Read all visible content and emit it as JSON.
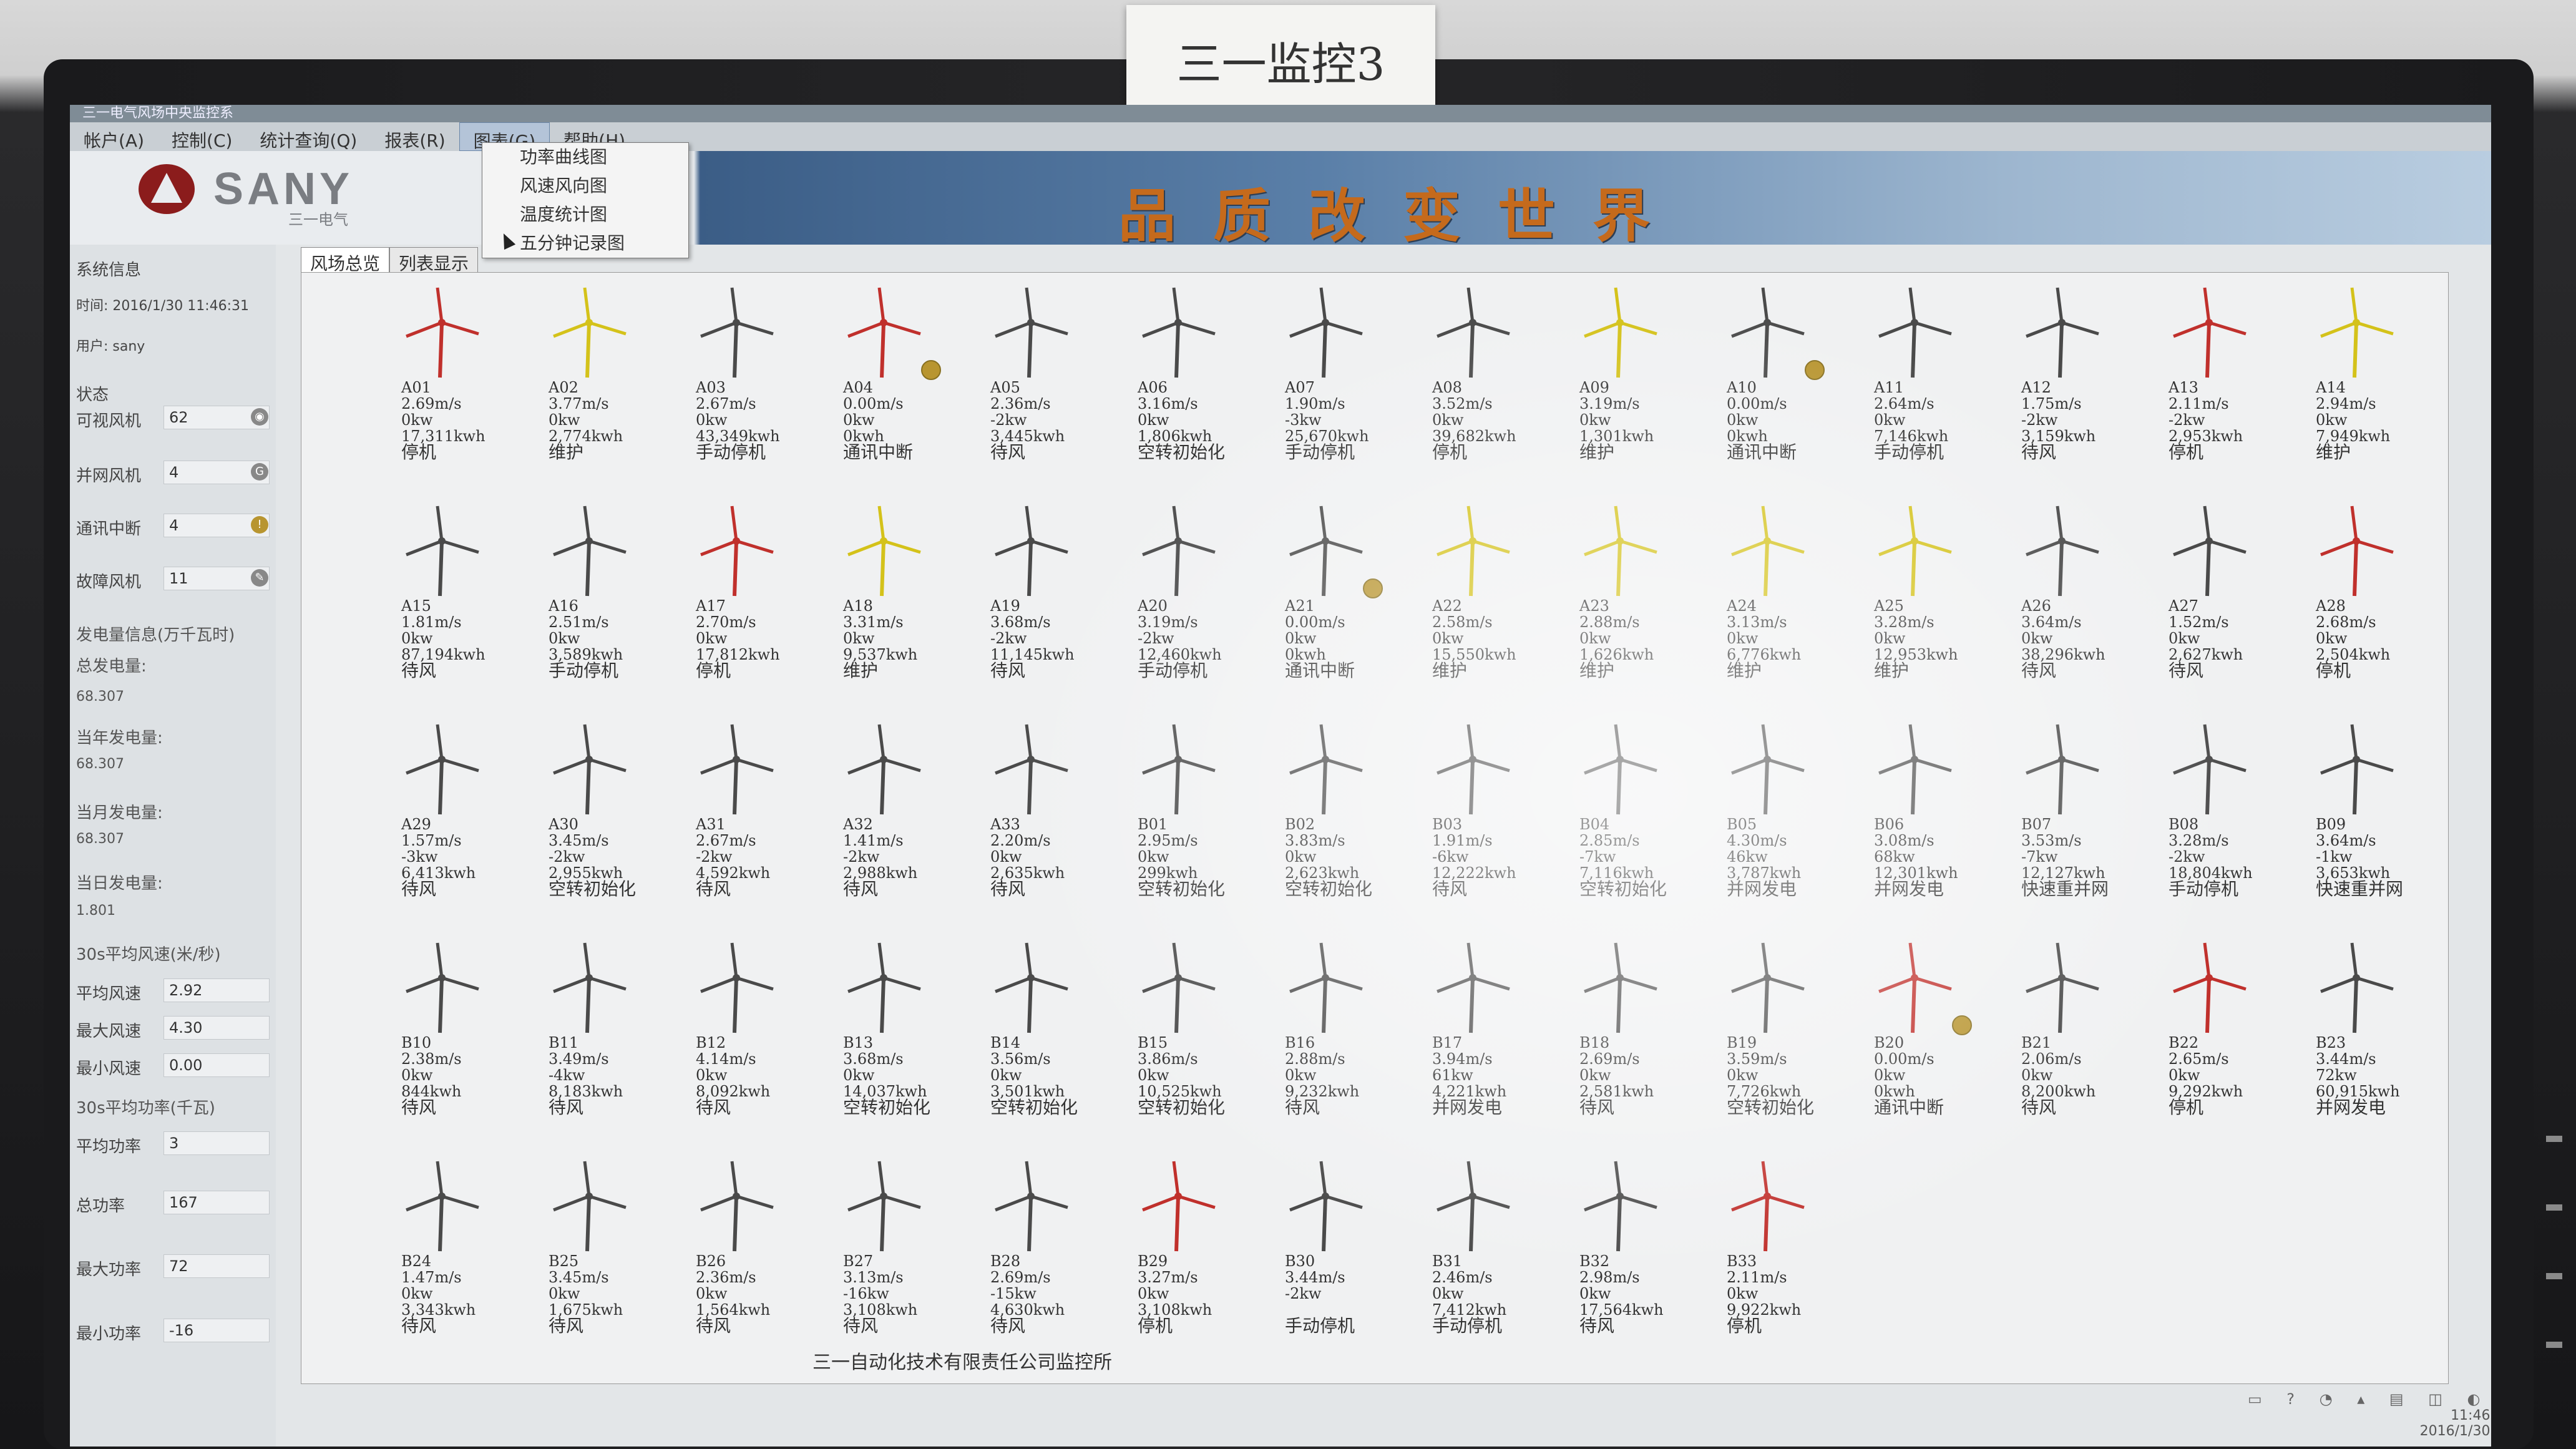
{
  "label_on_monitor": "三一监控3",
  "window_title": "三一电气风场中央监控系",
  "menu": [
    "帐户(A)",
    "控制(C)",
    "统计查询(Q)",
    "报表(R)",
    "图表(G)",
    "帮助(H)"
  ],
  "chart_menu_items": [
    "功率曲线图",
    "风速风向图",
    "温度统计图",
    "五分钟记录图"
  ],
  "brand": {
    "name": "SANY",
    "sub": "三一电气"
  },
  "slogan": "品质改变世界",
  "tabs": [
    "风场总览",
    "列表显示"
  ],
  "side": {
    "sys_info": "系统信息",
    "time": "时间: 2016/1/30 11:46:31",
    "user": "用户: sany",
    "status": "状态",
    "visible_label": "可视风机",
    "visible_value": "62",
    "grid_label": "并网风机",
    "grid_value": "4",
    "comm_label": "通讯中断",
    "comm_value": "4",
    "fault_label": "故障风机",
    "fault_value": "11",
    "gen_info": "发电量信息(万千瓦时)",
    "total_gen_label": "总发电量:",
    "total_gen": "68.307",
    "year_gen_label": "当年发电量:",
    "year_gen": "68.307",
    "month_gen_label": "当月发电量:",
    "month_gen": "68.307",
    "day_gen_label": "当日发电量:",
    "day_gen": "1.801",
    "wind_title": "30s平均风速(米/秒)",
    "avg_wind_label": "平均风速",
    "avg_wind": "2.92",
    "max_wind_label": "最大风速",
    "max_wind": "4.30",
    "min_wind_label": "最小风速",
    "min_wind": "0.00",
    "power_title": "30s平均功率(千瓦)",
    "avg_power_label": "平均功率",
    "avg_power": "3",
    "total_power_label": "总功率",
    "total_power": "167",
    "max_power_label": "最大功率",
    "max_power": "72",
    "min_power_label": "最小功率",
    "min_power": "-16"
  },
  "colors": {
    "red": "#c0302c",
    "yellow": "#d4c21a",
    "gray": "#4a4a4a",
    "faint": "#9aa0a4"
  },
  "turbines": [
    {
      "id": "A01",
      "wind": "2.69m/s",
      "power": "0kw",
      "energy": "17,311kwh",
      "status": "停机",
      "color": "red",
      "warn": false
    },
    {
      "id": "A02",
      "wind": "3.77m/s",
      "power": "0kw",
      "energy": "2,774kwh",
      "status": "维护",
      "color": "yellow",
      "warn": false
    },
    {
      "id": "A03",
      "wind": "2.67m/s",
      "power": "0kw",
      "energy": "43,349kwh",
      "status": "手动停机",
      "color": "gray",
      "warn": false
    },
    {
      "id": "A04",
      "wind": "0.00m/s",
      "power": "0kw",
      "energy": "0kwh",
      "status": "通讯中断",
      "color": "red",
      "warn": true
    },
    {
      "id": "A05",
      "wind": "2.36m/s",
      "power": "-2kw",
      "energy": "3,445kwh",
      "status": "待风",
      "color": "gray",
      "warn": false
    },
    {
      "id": "A06",
      "wind": "3.16m/s",
      "power": "0kw",
      "energy": "1,806kwh",
      "status": "空转初始化",
      "color": "gray",
      "warn": false
    },
    {
      "id": "A07",
      "wind": "1.90m/s",
      "power": "-3kw",
      "energy": "25,670kwh",
      "status": "手动停机",
      "color": "gray",
      "warn": false
    },
    {
      "id": "A08",
      "wind": "3.52m/s",
      "power": "0kw",
      "energy": "39,682kwh",
      "status": "停机",
      "color": "gray",
      "warn": false
    },
    {
      "id": "A09",
      "wind": "3.19m/s",
      "power": "0kw",
      "energy": "1,301kwh",
      "status": "维护",
      "color": "yellow",
      "warn": false
    },
    {
      "id": "A10",
      "wind": "0.00m/s",
      "power": "0kw",
      "energy": "0kwh",
      "status": "通讯中断",
      "color": "gray",
      "warn": true
    },
    {
      "id": "A11",
      "wind": "2.64m/s",
      "power": "0kw",
      "energy": "7,146kwh",
      "status": "手动停机",
      "color": "gray",
      "warn": false
    },
    {
      "id": "A12",
      "wind": "1.75m/s",
      "power": "-2kw",
      "energy": "3,159kwh",
      "status": "待风",
      "color": "gray",
      "warn": false
    },
    {
      "id": "A13",
      "wind": "2.11m/s",
      "power": "-2kw",
      "energy": "2,953kwh",
      "status": "停机",
      "color": "red",
      "warn": false
    },
    {
      "id": "A14",
      "wind": "2.94m/s",
      "power": "0kw",
      "energy": "7,949kwh",
      "status": "维护",
      "color": "yellow",
      "warn": false
    },
    {
      "id": "A15",
      "wind": "1.81m/s",
      "power": "0kw",
      "energy": "87,194kwh",
      "status": "待风",
      "color": "gray",
      "warn": false
    },
    {
      "id": "A16",
      "wind": "2.51m/s",
      "power": "0kw",
      "energy": "3,589kwh",
      "status": "手动停机",
      "color": "gray",
      "warn": false
    },
    {
      "id": "A17",
      "wind": "2.70m/s",
      "power": "0kw",
      "energy": "17,812kwh",
      "status": "停机",
      "color": "red",
      "warn": false
    },
    {
      "id": "A18",
      "wind": "3.31m/s",
      "power": "0kw",
      "energy": "9,537kwh",
      "status": "维护",
      "color": "yellow",
      "warn": false
    },
    {
      "id": "A19",
      "wind": "3.68m/s",
      "power": "-2kw",
      "energy": "11,145kwh",
      "status": "待风",
      "color": "gray",
      "warn": false
    },
    {
      "id": "A20",
      "wind": "3.19m/s",
      "power": "-2kw",
      "energy": "12,460kwh",
      "status": "手动停机",
      "color": "gray",
      "warn": false
    },
    {
      "id": "A21",
      "wind": "0.00m/s",
      "power": "0kw",
      "energy": "0kwh",
      "status": "通讯中断",
      "color": "gray",
      "warn": true
    },
    {
      "id": "A22",
      "wind": "2.58m/s",
      "power": "0kw",
      "energy": "15,550kwh",
      "status": "维护",
      "color": "yellow",
      "warn": false
    },
    {
      "id": "A23",
      "wind": "2.88m/s",
      "power": "0kw",
      "energy": "1,626kwh",
      "status": "维护",
      "color": "yellow",
      "warn": false
    },
    {
      "id": "A24",
      "wind": "3.13m/s",
      "power": "0kw",
      "energy": "6,776kwh",
      "status": "维护",
      "color": "yellow",
      "warn": false
    },
    {
      "id": "A25",
      "wind": "3.28m/s",
      "power": "0kw",
      "energy": "12,953kwh",
      "status": "维护",
      "color": "yellow",
      "warn": false
    },
    {
      "id": "A26",
      "wind": "3.64m/s",
      "power": "0kw",
      "energy": "38,296kwh",
      "status": "待风",
      "color": "gray",
      "warn": false
    },
    {
      "id": "A27",
      "wind": "1.52m/s",
      "power": "0kw",
      "energy": "2,627kwh",
      "status": "待风",
      "color": "gray",
      "warn": false
    },
    {
      "id": "A28",
      "wind": "2.68m/s",
      "power": "0kw",
      "energy": "2,504kwh",
      "status": "停机",
      "color": "red",
      "warn": false
    },
    {
      "id": "A29",
      "wind": "1.57m/s",
      "power": "-3kw",
      "energy": "6,413kwh",
      "status": "待风",
      "color": "gray",
      "warn": false
    },
    {
      "id": "A30",
      "wind": "3.45m/s",
      "power": "-2kw",
      "energy": "2,955kwh",
      "status": "空转初始化",
      "color": "gray",
      "warn": false
    },
    {
      "id": "A31",
      "wind": "2.67m/s",
      "power": "-2kw",
      "energy": "4,592kwh",
      "status": "待风",
      "color": "gray",
      "warn": false
    },
    {
      "id": "A32",
      "wind": "1.41m/s",
      "power": "-2kw",
      "energy": "2,988kwh",
      "status": "待风",
      "color": "gray",
      "warn": false
    },
    {
      "id": "A33",
      "wind": "2.20m/s",
      "power": "0kw",
      "energy": "2,635kwh",
      "status": "待风",
      "color": "gray",
      "warn": false
    },
    {
      "id": "B01",
      "wind": "2.95m/s",
      "power": "0kw",
      "energy": "299kwh",
      "status": "空转初始化",
      "color": "gray",
      "warn": false
    },
    {
      "id": "B02",
      "wind": "3.83m/s",
      "power": "0kw",
      "energy": "2,623kwh",
      "status": "空转初始化",
      "color": "gray",
      "warn": false
    },
    {
      "id": "B03",
      "wind": "1.91m/s",
      "power": "-6kw",
      "energy": "12,222kwh",
      "status": "待风",
      "color": "gray",
      "warn": false
    },
    {
      "id": "B04",
      "wind": "2.85m/s",
      "power": "-7kw",
      "energy": "7,116kwh",
      "status": "空转初始化",
      "color": "gray",
      "warn": false
    },
    {
      "id": "B05",
      "wind": "4.30m/s",
      "power": "46kw",
      "energy": "3,787kwh",
      "status": "并网发电",
      "color": "gray",
      "warn": false
    },
    {
      "id": "B06",
      "wind": "3.08m/s",
      "power": "68kw",
      "energy": "12,301kwh",
      "status": "并网发电",
      "color": "gray",
      "warn": false
    },
    {
      "id": "B07",
      "wind": "3.53m/s",
      "power": "-7kw",
      "energy": "12,127kwh",
      "status": "快速重并网",
      "color": "gray",
      "warn": false
    },
    {
      "id": "B08",
      "wind": "3.28m/s",
      "power": "-2kw",
      "energy": "18,804kwh",
      "status": "手动停机",
      "color": "gray",
      "warn": false
    },
    {
      "id": "B09",
      "wind": "3.64m/s",
      "power": "-1kw",
      "energy": "3,653kwh",
      "status": "快速重并网",
      "color": "gray",
      "warn": false
    },
    {
      "id": "B10",
      "wind": "2.38m/s",
      "power": "0kw",
      "energy": "844kwh",
      "status": "待风",
      "color": "gray",
      "warn": false
    },
    {
      "id": "B11",
      "wind": "3.49m/s",
      "power": "-4kw",
      "energy": "8,183kwh",
      "status": "待风",
      "color": "gray",
      "warn": false
    },
    {
      "id": "B12",
      "wind": "4.14m/s",
      "power": "0kw",
      "energy": "8,092kwh",
      "status": "待风",
      "color": "gray",
      "warn": false
    },
    {
      "id": "B13",
      "wind": "3.68m/s",
      "power": "0kw",
      "energy": "14,037kwh",
      "status": "空转初始化",
      "color": "gray",
      "warn": false
    },
    {
      "id": "B14",
      "wind": "3.56m/s",
      "power": "0kw",
      "energy": "3,501kwh",
      "status": "空转初始化",
      "color": "gray",
      "warn": false
    },
    {
      "id": "B15",
      "wind": "3.86m/s",
      "power": "0kw",
      "energy": "10,525kwh",
      "status": "空转初始化",
      "color": "gray",
      "warn": false
    },
    {
      "id": "B16",
      "wind": "2.88m/s",
      "power": "0kw",
      "energy": "9,232kwh",
      "status": "待风",
      "color": "gray",
      "warn": false
    },
    {
      "id": "B17",
      "wind": "3.94m/s",
      "power": "61kw",
      "energy": "4,221kwh",
      "status": "并网发电",
      "color": "gray",
      "warn": false
    },
    {
      "id": "B18",
      "wind": "2.69m/s",
      "power": "0kw",
      "energy": "2,581kwh",
      "status": "待风",
      "color": "gray",
      "warn": false
    },
    {
      "id": "B19",
      "wind": "3.59m/s",
      "power": "0kw",
      "energy": "7,726kwh",
      "status": "空转初始化",
      "color": "gray",
      "warn": false
    },
    {
      "id": "B20",
      "wind": "0.00m/s",
      "power": "0kw",
      "energy": "0kwh",
      "status": "通讯中断",
      "color": "red",
      "warn": true
    },
    {
      "id": "B21",
      "wind": "2.06m/s",
      "power": "0kw",
      "energy": "8,200kwh",
      "status": "待风",
      "color": "gray",
      "warn": false
    },
    {
      "id": "B22",
      "wind": "2.65m/s",
      "power": "0kw",
      "energy": "9,292kwh",
      "status": "停机",
      "color": "red",
      "warn": false
    },
    {
      "id": "B23",
      "wind": "3.44m/s",
      "power": "72kw",
      "energy": "60,915kwh",
      "status": "并网发电",
      "color": "gray",
      "warn": false
    },
    {
      "id": "B24",
      "wind": "1.47m/s",
      "power": "0kw",
      "energy": "3,343kwh",
      "status": "待风",
      "color": "gray",
      "warn": false
    },
    {
      "id": "B25",
      "wind": "3.45m/s",
      "power": "0kw",
      "energy": "1,675kwh",
      "status": "待风",
      "color": "gray",
      "warn": false
    },
    {
      "id": "B26",
      "wind": "2.36m/s",
      "power": "0kw",
      "energy": "1,564kwh",
      "status": "待风",
      "color": "gray",
      "warn": false
    },
    {
      "id": "B27",
      "wind": "3.13m/s",
      "power": "-16kw",
      "energy": "3,108kwh",
      "status": "待风",
      "color": "gray",
      "warn": false
    },
    {
      "id": "B28",
      "wind": "2.69m/s",
      "power": "-15kw",
      "energy": "4,630kwh",
      "status": "待风",
      "color": "gray",
      "warn": false
    },
    {
      "id": "B29",
      "wind": "3.27m/s",
      "power": "0kw",
      "energy": "3,108kwh",
      "status": "停机",
      "color": "red",
      "warn": false
    },
    {
      "id": "B30",
      "wind": "3.44m/s",
      "power": "-2kw",
      "energy": "",
      "status": "手动停机",
      "color": "gray",
      "warn": false
    },
    {
      "id": "B31",
      "wind": "2.46m/s",
      "power": "0kw",
      "energy": "7,412kwh",
      "status": "手动停机",
      "color": "gray",
      "warn": false
    },
    {
      "id": "B32",
      "wind": "2.98m/s",
      "power": "0kw",
      "energy": "17,564kwh",
      "status": "待风",
      "color": "gray",
      "warn": false
    },
    {
      "id": "B33",
      "wind": "2.11m/s",
      "power": "0kw",
      "energy": "9,922kwh",
      "status": "停机",
      "color": "red",
      "warn": false
    }
  ],
  "footer": "三一自动化技术有限责任公司监控所",
  "clock": {
    "time": "11:46",
    "date": "2016/1/30"
  }
}
